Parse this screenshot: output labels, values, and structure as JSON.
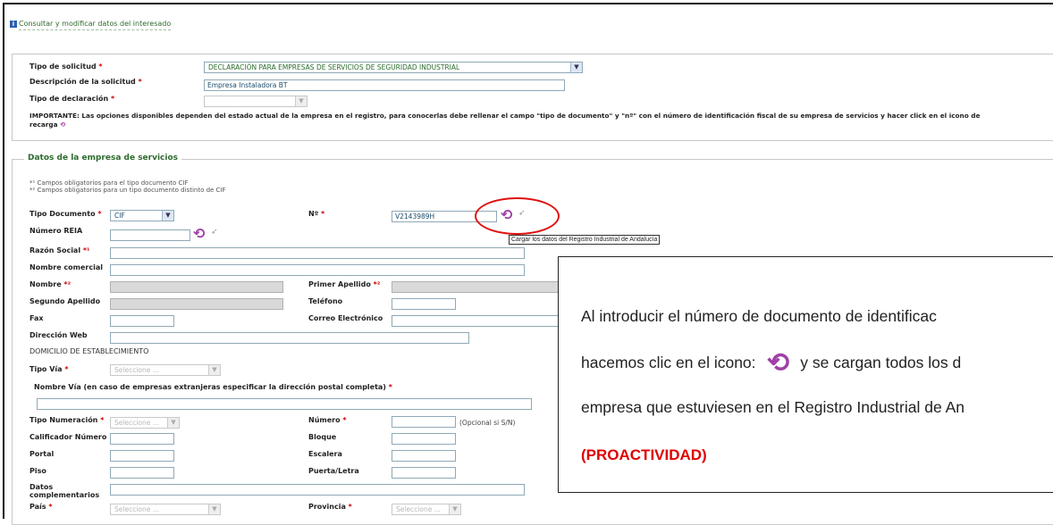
{
  "header": {
    "info_icon": "info-icon",
    "link_label": "Consultar y modificar datos del interesado"
  },
  "solicitud": {
    "tipo_label": "Tipo de solicitud",
    "tipo_value": "DECLARACIÓN PARA EMPRESAS DE SERVICIOS DE SEGURIDAD INDUSTRIAL",
    "descripcion_label": "Descripción de la solicitud",
    "descripcion_value": "Empresa Instaladora BT",
    "declaracion_label": "Tipo de declaración",
    "declaracion_value": "",
    "important_line1": "IMPORTANTE: Las opciones disponibles dependen del estado actual de la empresa en el registro, para conocerlas debe rellenar el campo \"tipo de documento\" y \"nº\" con el número de identificación fiscal de su empresa de servicios y hacer click en el icono de",
    "important_line2": "recarga"
  },
  "empresa": {
    "legend": "Datos de la empresa de servicios",
    "note1": "*¹ Campos obligatorios para el tipo documento CIF",
    "note2": "*² Campos obligatorios para un tipo documento distinto de CIF",
    "tipo_doc_label": "Tipo Documento",
    "tipo_doc_value": "CIF",
    "num_label": "Nº",
    "num_value": "V2143989H",
    "tooltip": "Cargar los datos del Registro Industrial de Andalucía",
    "reia_label": "Número REIA",
    "razon_label": "Razón Social",
    "comercial_label": "Nombre comercial",
    "nombre_label": "Nombre",
    "apellido1_label": "Primer Apellido",
    "apellido2_label": "Segundo Apellido",
    "telefono_label": "Teléfono",
    "fax_label": "Fax",
    "correo_label": "Correo Electrónico",
    "web_label": "Dirección Web",
    "domicilio_title": "DOMICILIO DE ESTABLECIMIENTO",
    "via_label": "Tipo Vía",
    "select_placeholder": "Seleccione ...",
    "nombre_via_label": "Nombre Vía (en caso de empresas extranjeras especificar la dirección postal completa)",
    "numeracion_label": "Tipo Numeración",
    "numero_label": "Número",
    "opcional": "(Opcional si S/N)",
    "calificador_label": "Calificador Número",
    "bloque_label": "Bloque",
    "portal_label": "Portal",
    "escalera_label": "Escalera",
    "piso_label": "Piso",
    "puerta_label": "Puerta/Letra",
    "datos_comp_label1": "Datos",
    "datos_comp_label2": "complementarios",
    "pais_label": "País",
    "provincia_label": "Provincia",
    "req1": "*¹",
    "req2": "*²",
    "star": "*"
  },
  "callout": {
    "line1": "Al introducir el número de documento de identificac",
    "line2a": "hacemos clic en el icono:",
    "line2b": "y se cargan todos los d",
    "line3": "empresa que estuviesen en el Registro Industrial de An",
    "line4": "(PROACTIVIDAD)"
  },
  "colors": {
    "accent_green": "#2d6a2d",
    "reload_purple": "#a040a8",
    "highlight_red": "#e01010"
  }
}
